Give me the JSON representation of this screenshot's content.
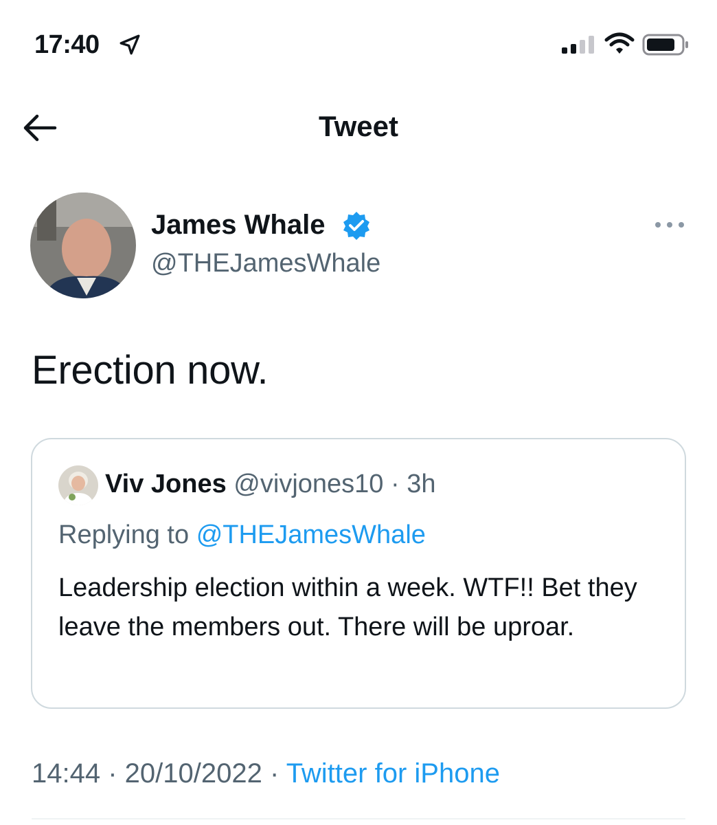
{
  "status_bar": {
    "time": "17:40"
  },
  "header": {
    "title": "Tweet"
  },
  "tweet": {
    "author_name": "James Whale",
    "author_handle": "@THEJamesWhale",
    "verified": true,
    "text": "Erection now.",
    "timestamp": "14:44",
    "date": "20/10/2022",
    "separator": " · ",
    "source": "Twitter for iPhone"
  },
  "quoted_tweet": {
    "author_name": "Viv Jones",
    "author_handle": "@vivjones10",
    "time_ago": "3h",
    "replying_label": "Replying to",
    "replying_to": "@THEJamesWhale",
    "text": "Leadership election within a week. WTF!! Bet they leave the members out. There will be uproar."
  },
  "colors": {
    "accent": "#1d9bf0",
    "secondary_text": "#536471",
    "border": "#cfd9de"
  }
}
